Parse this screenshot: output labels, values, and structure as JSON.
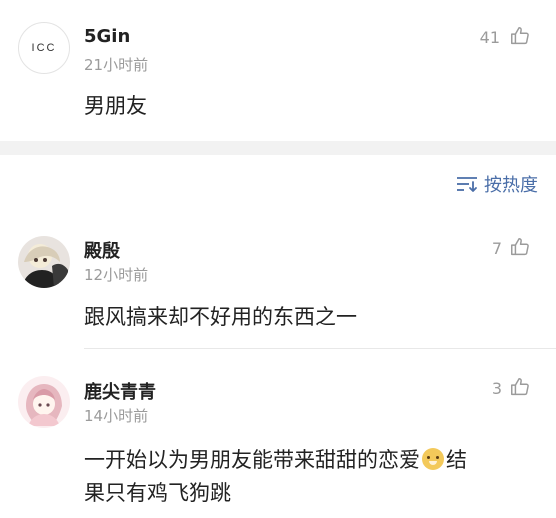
{
  "top_comment": {
    "avatar_text": "ICC",
    "username": "5Gin",
    "time": "21小时前",
    "text": "男朋友",
    "likes": "41"
  },
  "sort": {
    "label": "按热度",
    "icon": "sort-lines-icon"
  },
  "comments": [
    {
      "username": "殿殷",
      "time": "12小时前",
      "text": "跟风搞来却不好用的东西之一",
      "likes": "7"
    },
    {
      "username": "鹿尖青青",
      "time": "14小时前",
      "text_part1": "一开始以为男朋友能带来甜甜的恋爱",
      "emoji": "doge-icon",
      "text_part2": "结",
      "text_line2": "果只有鸡飞狗跳",
      "likes": "3"
    }
  ],
  "colors": {
    "accent": "#4a6ea8",
    "muted": "#9b9b9b",
    "band": "#f2f2f2"
  }
}
